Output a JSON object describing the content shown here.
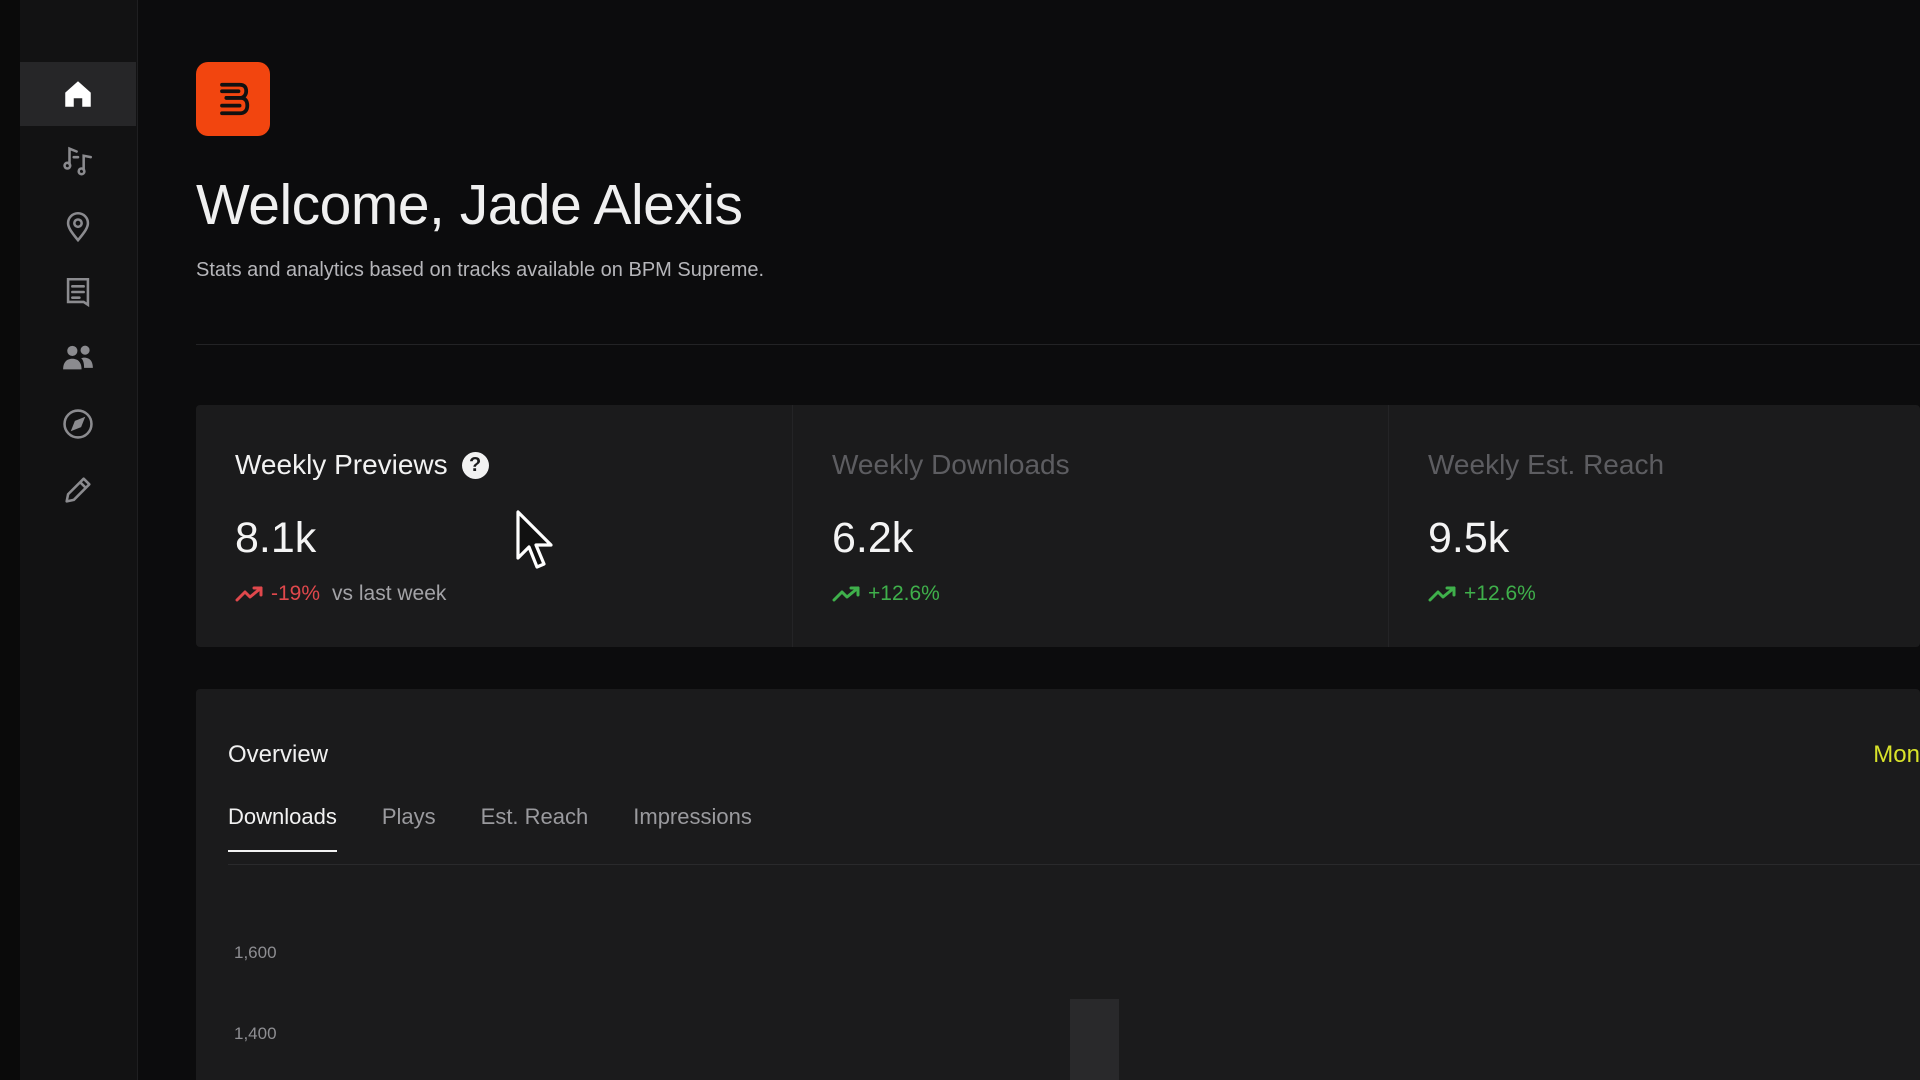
{
  "sidebar": {
    "items": [
      {
        "icon": "home-icon",
        "active": true
      },
      {
        "icon": "music-icon",
        "active": false
      },
      {
        "icon": "location-pin-icon",
        "active": false
      },
      {
        "icon": "document-list-icon",
        "active": false
      },
      {
        "icon": "users-icon",
        "active": false
      },
      {
        "icon": "compass-icon",
        "active": false
      },
      {
        "icon": "pencil-icon",
        "active": false
      }
    ]
  },
  "header": {
    "logo_icon": "bpm-logo-icon",
    "brand_color": "#f2450f",
    "welcome": "Welcome, Jade Alexis",
    "subtitle": "Stats and analytics based on tracks available on BPM Supreme."
  },
  "stats": [
    {
      "title": "Weekly Previews",
      "value": "8.1k",
      "delta": "-19%",
      "note": "vs last week",
      "trend": "negative"
    },
    {
      "title": "Weekly Downloads",
      "value": "6.2k",
      "delta": "+12.6%",
      "trend": "positive"
    },
    {
      "title": "Weekly Est. Reach",
      "value": "9.5k",
      "delta": "+12.6%",
      "trend": "positive"
    }
  ],
  "overview": {
    "title": "Overview",
    "period": "Month",
    "tabs": [
      {
        "label": "Downloads",
        "active": true
      },
      {
        "label": "Plays",
        "active": false
      },
      {
        "label": "Est. Reach",
        "active": false
      },
      {
        "label": "Impressions",
        "active": false
      }
    ],
    "y_ticks": [
      "1,600",
      "1,400"
    ]
  },
  "colors": {
    "negative": "#e0484c",
    "positive": "#3fb04b",
    "period_accent": "#d8e22a"
  }
}
